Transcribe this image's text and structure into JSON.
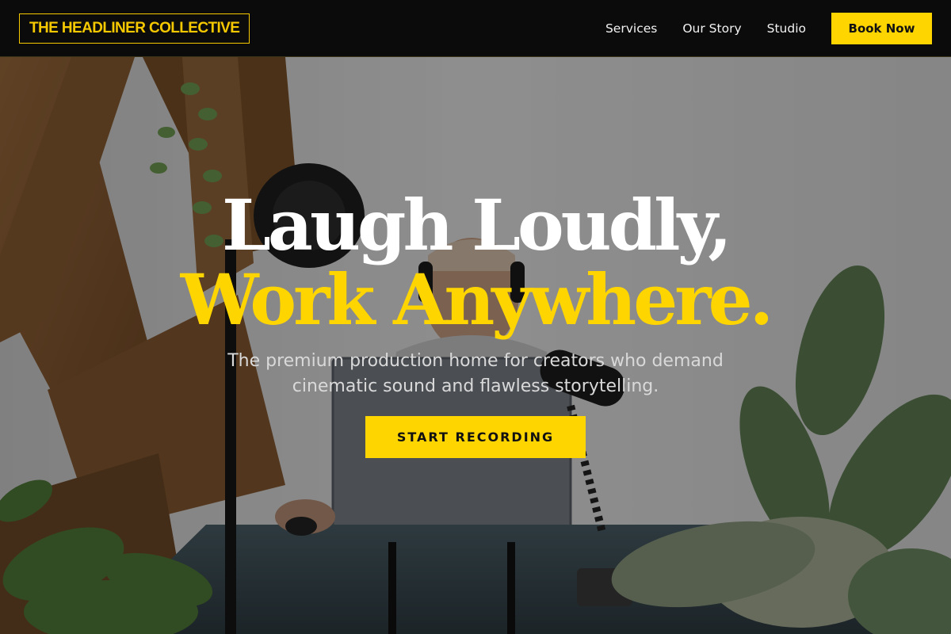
{
  "header": {
    "logo_text": "THE HEADLINER COLLECTIVE",
    "nav": [
      {
        "label": "Services"
      },
      {
        "label": "Our Story"
      },
      {
        "label": "Studio"
      }
    ],
    "cta_label": "Book Now"
  },
  "hero": {
    "headline_line1": "Laugh Loudly,",
    "headline_line2": "Work Anywhere.",
    "subtitle": "The premium production home for creators who demand cinematic sound and flawless storytelling.",
    "cta_label": "START RECORDING",
    "background": "podcast-studio-photo"
  },
  "colors": {
    "accent": "#ffd500",
    "header_bg": "#0b0b0b",
    "headline_white": "#ffffff",
    "subtitle_gray": "#d9d9d9"
  }
}
